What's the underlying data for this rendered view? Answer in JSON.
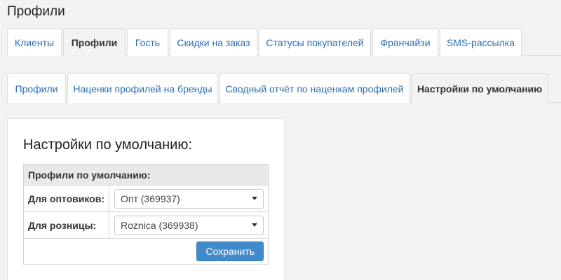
{
  "page": {
    "title": "Профили"
  },
  "main_tabs": [
    {
      "label": "Клиенты",
      "active": false
    },
    {
      "label": "Профили",
      "active": true
    },
    {
      "label": "Гость",
      "active": false
    },
    {
      "label": "Скидки на заказ",
      "active": false
    },
    {
      "label": "Статусы покупателей",
      "active": false
    },
    {
      "label": "Франчайзи",
      "active": false
    },
    {
      "label": "SMS-рассылка",
      "active": false
    }
  ],
  "sub_tabs": [
    {
      "label": "Профили",
      "active": false
    },
    {
      "label": "Наценки профилей на бренды",
      "active": false
    },
    {
      "label": "Сводный отчёт по наценкам профилей",
      "active": false
    },
    {
      "label": "Настройки по умолчанию",
      "active": true
    }
  ],
  "panel": {
    "title": "Настройки по умолчанию:",
    "table_header": "Профили по умолчанию:",
    "rows": [
      {
        "label": "Для оптовиков:",
        "value": "Опт (369937)"
      },
      {
        "label": "Для розницы:",
        "value": "Roznica (369938)"
      }
    ],
    "save_label": "Сохранить"
  },
  "colors": {
    "link": "#2a6eb1",
    "primary_button": "#428bca",
    "background": "#f2f2f2"
  }
}
